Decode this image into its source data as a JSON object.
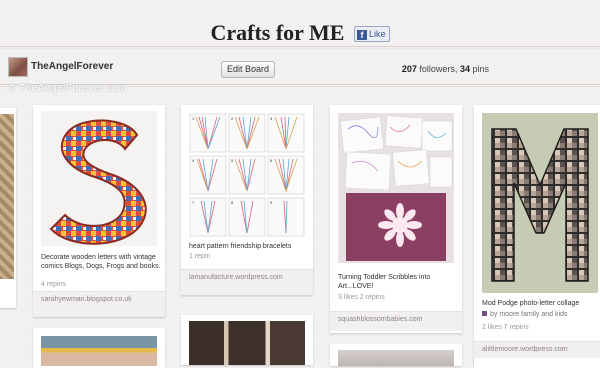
{
  "board": {
    "title": "Crafts for ME",
    "like_label": "Like",
    "owner": "TheAngelForever",
    "edit_label": "Edit Board",
    "followers": "207",
    "followers_label": "followers,",
    "pins": "34",
    "pins_label": "pins"
  },
  "watermark": "© TheAngelForever.com",
  "pins": [
    {
      "description": "Decorate wooden letters with vintage comics Blogs, Dogs, Frogs and books.",
      "stats": "4 repins",
      "source": "sarahyewman.blogspot.co.uk"
    },
    {
      "description": "heart pattern friendship bracelets",
      "stats": "1 repin",
      "source": "lamanufacture.wordpress.com"
    },
    {
      "description": "Turning Toddler Scribbles into Art...LOVE!",
      "stats": "3 likes   2 repins",
      "source": "squashblossombabies.com"
    },
    {
      "description": "Mod Podge photo-letter collage",
      "byline": "by moore family and kids",
      "stats": "2 likes   7 repins",
      "source": "alittlemoore.wordpress.com"
    }
  ],
  "colors": {
    "background": "#f4f2f1",
    "facebook_blue": "#3b5998",
    "source_bar": "#f2f0ef"
  }
}
